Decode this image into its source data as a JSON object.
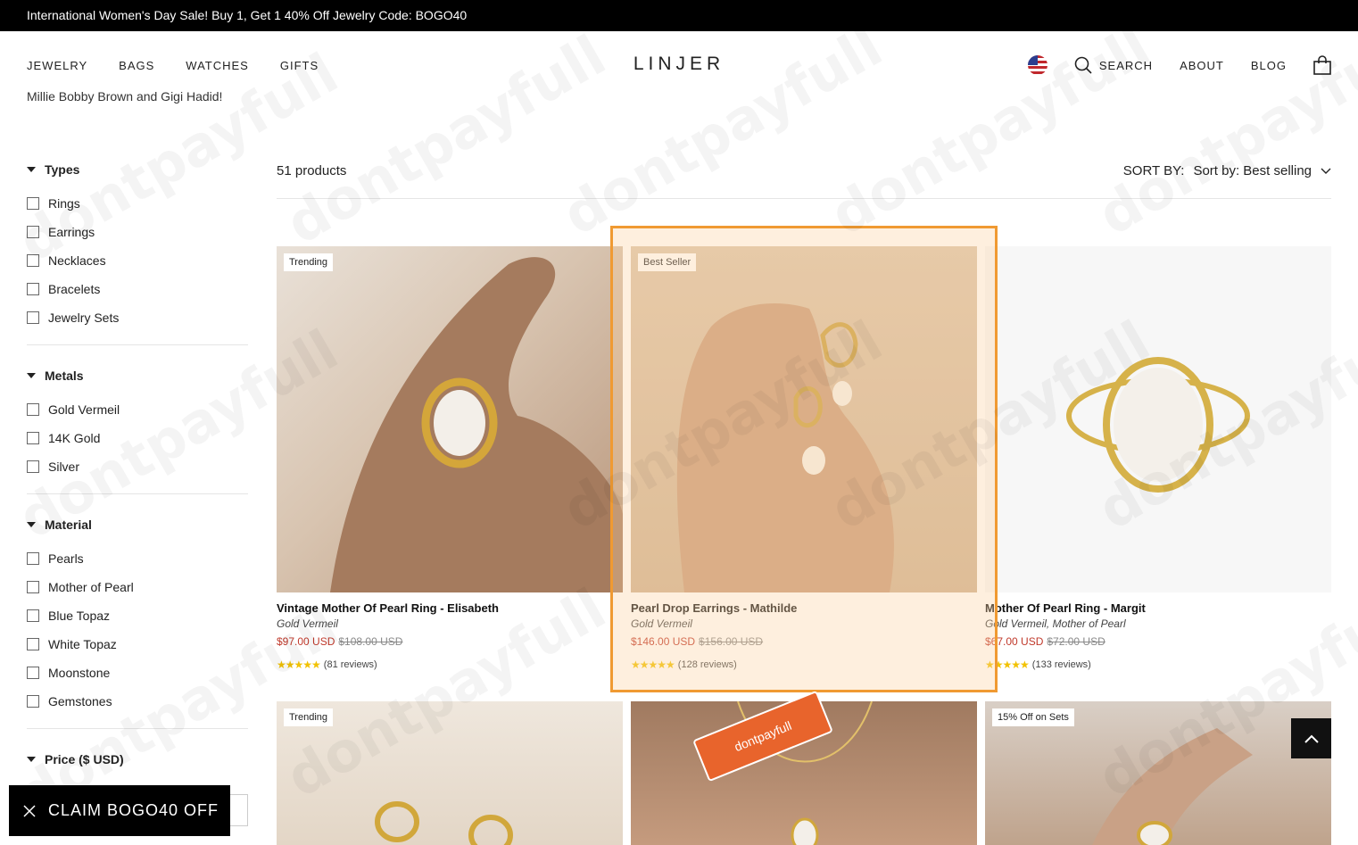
{
  "announcement": "International Women's Day Sale! Buy 1, Get 1 40% Off Jewelry Code: BOGO40",
  "header": {
    "logo": "LINJER",
    "nav_left": [
      "JEWELRY",
      "BAGS",
      "WATCHES",
      "GIFTS"
    ],
    "search_label": "SEARCH",
    "about_label": "ABOUT",
    "blog_label": "BLOG"
  },
  "intro_text": "Millie Bobby Brown and Gigi Hadid!",
  "filters": {
    "types": {
      "title": "Types",
      "options": [
        "Rings",
        "Earrings",
        "Necklaces",
        "Bracelets",
        "Jewelry Sets"
      ]
    },
    "metals": {
      "title": "Metals",
      "options": [
        "Gold Vermeil",
        "14K Gold",
        "Silver"
      ]
    },
    "material": {
      "title": "Material",
      "options": [
        "Pearls",
        "Mother of Pearl",
        "Blue Topaz",
        "White Topaz",
        "Moonstone",
        "Gemstones"
      ]
    },
    "price": {
      "title": "Price ($ USD)"
    }
  },
  "listing": {
    "count": "51 products",
    "sort_label": "SORT BY:",
    "sort_value": "Sort by: Best selling"
  },
  "products": [
    {
      "badge": "Trending",
      "name": "Vintage Mother Of Pearl Ring - Elisabeth",
      "material": "Gold Vermeil",
      "price": "$97.00 USD",
      "was": "$108.00 USD",
      "reviews": "(81 reviews)"
    },
    {
      "badge": "Best Seller",
      "name": "Pearl Drop Earrings - Mathilde",
      "material": "Gold Vermeil",
      "price": "$146.00 USD",
      "was": "$156.00 USD",
      "reviews": "(128 reviews)"
    },
    {
      "badge": "",
      "name": "Mother Of Pearl Ring - Margit",
      "material": "Gold Vermeil, Mother of Pearl",
      "price": "$67.00 USD",
      "was": "$72.00 USD",
      "reviews": "(133 reviews)"
    },
    {
      "badge": "Trending"
    },
    {
      "badge": ""
    },
    {
      "badge": "15% Off on Sets"
    }
  ],
  "stars": "★★★★★",
  "claim_label": "CLAIM BOGO40 OFF",
  "watermark": "dontpayfull",
  "colors": {
    "accent": "#f09a32",
    "sale_price": "#c0392b",
    "star": "#f2c200"
  }
}
